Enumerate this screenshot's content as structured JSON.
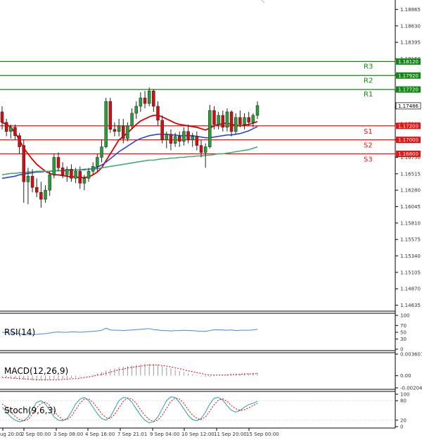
{
  "chart_data": {
    "type": "candlestick",
    "symbol_note": "",
    "price_axis": {
      "ylim": [
        1.1455,
        1.19
      ],
      "ticks": [
        "1.18865",
        "1.18630",
        "1.18395",
        "1.18160",
        "1.17930",
        "1.17700",
        "1.17465",
        "1.17230",
        "1.17000",
        "1.16750",
        "1.16515",
        "1.16280",
        "1.16045",
        "1.15810",
        "1.15575",
        "1.15340",
        "1.15105",
        "1.14870",
        "1.14635"
      ]
    },
    "time_axis": {
      "labels": [
        "ug 20:00",
        "2 Sep 00:00",
        "3 Sep 08:00",
        "4 Sep 16:00",
        "7 Sep 21:01",
        "9 Sep 04:00",
        "10 Sep 12:00",
        "11 Sep 20:00",
        "15 Sep 00:00"
      ]
    },
    "candles": [
      {
        "o": 1.174,
        "h": 1.1748,
        "l": 1.1715,
        "c": 1.1725
      },
      {
        "o": 1.1725,
        "h": 1.173,
        "l": 1.1705,
        "c": 1.1712
      },
      {
        "o": 1.1712,
        "h": 1.1722,
        "l": 1.1702,
        "c": 1.1718
      },
      {
        "o": 1.1718,
        "h": 1.1722,
        "l": 1.17,
        "c": 1.1706
      },
      {
        "o": 1.1706,
        "h": 1.171,
        "l": 1.168,
        "c": 1.169
      },
      {
        "o": 1.1692,
        "h": 1.17,
        "l": 1.161,
        "c": 1.164
      },
      {
        "o": 1.164,
        "h": 1.166,
        "l": 1.1608,
        "c": 1.1648
      },
      {
        "o": 1.1648,
        "h": 1.1658,
        "l": 1.1625,
        "c": 1.1632
      },
      {
        "o": 1.1632,
        "h": 1.1645,
        "l": 1.1618,
        "c": 1.1625
      },
      {
        "o": 1.1625,
        "h": 1.164,
        "l": 1.1603,
        "c": 1.1615
      },
      {
        "o": 1.1615,
        "h": 1.1635,
        "l": 1.161,
        "c": 1.1628
      },
      {
        "o": 1.1628,
        "h": 1.1655,
        "l": 1.162,
        "c": 1.165
      },
      {
        "o": 1.165,
        "h": 1.168,
        "l": 1.1645,
        "c": 1.1675
      },
      {
        "o": 1.1675,
        "h": 1.1682,
        "l": 1.1655,
        "c": 1.166
      },
      {
        "o": 1.166,
        "h": 1.1668,
        "l": 1.1645,
        "c": 1.165
      },
      {
        "o": 1.165,
        "h": 1.1662,
        "l": 1.164,
        "c": 1.1658
      },
      {
        "o": 1.1658,
        "h": 1.1665,
        "l": 1.164,
        "c": 1.1645
      },
      {
        "o": 1.1645,
        "h": 1.166,
        "l": 1.1638,
        "c": 1.1655
      },
      {
        "o": 1.1655,
        "h": 1.1662,
        "l": 1.163,
        "c": 1.1638
      },
      {
        "o": 1.1638,
        "h": 1.165,
        "l": 1.1628,
        "c": 1.1645
      },
      {
        "o": 1.1645,
        "h": 1.166,
        "l": 1.164,
        "c": 1.1655
      },
      {
        "o": 1.1655,
        "h": 1.1668,
        "l": 1.165,
        "c": 1.1662
      },
      {
        "o": 1.1662,
        "h": 1.168,
        "l": 1.1655,
        "c": 1.1675
      },
      {
        "o": 1.1675,
        "h": 1.17,
        "l": 1.1668,
        "c": 1.169
      },
      {
        "o": 1.169,
        "h": 1.176,
        "l": 1.1688,
        "c": 1.1755
      },
      {
        "o": 1.1755,
        "h": 1.176,
        "l": 1.171,
        "c": 1.1715
      },
      {
        "o": 1.1715,
        "h": 1.1725,
        "l": 1.1705,
        "c": 1.1712
      },
      {
        "o": 1.1712,
        "h": 1.173,
        "l": 1.1705,
        "c": 1.172
      },
      {
        "o": 1.172,
        "h": 1.173,
        "l": 1.1695,
        "c": 1.1702
      },
      {
        "o": 1.1702,
        "h": 1.1725,
        "l": 1.1698,
        "c": 1.172
      },
      {
        "o": 1.172,
        "h": 1.1745,
        "l": 1.1715,
        "c": 1.1738
      },
      {
        "o": 1.1738,
        "h": 1.1755,
        "l": 1.173,
        "c": 1.1748
      },
      {
        "o": 1.1748,
        "h": 1.1768,
        "l": 1.174,
        "c": 1.176
      },
      {
        "o": 1.176,
        "h": 1.177,
        "l": 1.1745,
        "c": 1.1752
      },
      {
        "o": 1.1752,
        "h": 1.1775,
        "l": 1.1748,
        "c": 1.177
      },
      {
        "o": 1.177,
        "h": 1.1772,
        "l": 1.174,
        "c": 1.1748
      },
      {
        "o": 1.1748,
        "h": 1.1755,
        "l": 1.172,
        "c": 1.1728
      },
      {
        "o": 1.1728,
        "h": 1.1735,
        "l": 1.1695,
        "c": 1.17
      },
      {
        "o": 1.17,
        "h": 1.1712,
        "l": 1.1688,
        "c": 1.1708
      },
      {
        "o": 1.1708,
        "h": 1.1715,
        "l": 1.1685,
        "c": 1.1695
      },
      {
        "o": 1.1695,
        "h": 1.171,
        "l": 1.169,
        "c": 1.1705
      },
      {
        "o": 1.1705,
        "h": 1.1712,
        "l": 1.169,
        "c": 1.1698
      },
      {
        "o": 1.1698,
        "h": 1.1718,
        "l": 1.1692,
        "c": 1.1712
      },
      {
        "o": 1.1712,
        "h": 1.1722,
        "l": 1.1695,
        "c": 1.17
      },
      {
        "o": 1.17,
        "h": 1.171,
        "l": 1.169,
        "c": 1.1705
      },
      {
        "o": 1.1705,
        "h": 1.1712,
        "l": 1.1685,
        "c": 1.1692
      },
      {
        "o": 1.1692,
        "h": 1.17,
        "l": 1.1675,
        "c": 1.1682
      },
      {
        "o": 1.1682,
        "h": 1.1695,
        "l": 1.166,
        "c": 1.169
      },
      {
        "o": 1.169,
        "h": 1.175,
        "l": 1.1688,
        "c": 1.1742
      },
      {
        "o": 1.1742,
        "h": 1.1748,
        "l": 1.1715,
        "c": 1.1722
      },
      {
        "o": 1.1722,
        "h": 1.174,
        "l": 1.1715,
        "c": 1.1735
      },
      {
        "o": 1.1735,
        "h": 1.1742,
        "l": 1.1712,
        "c": 1.1718
      },
      {
        "o": 1.1718,
        "h": 1.1745,
        "l": 1.1712,
        "c": 1.174
      },
      {
        "o": 1.174,
        "h": 1.1742,
        "l": 1.1705,
        "c": 1.1712
      },
      {
        "o": 1.1712,
        "h": 1.1738,
        "l": 1.1708,
        "c": 1.1732
      },
      {
        "o": 1.1732,
        "h": 1.1742,
        "l": 1.1718,
        "c": 1.1722
      },
      {
        "o": 1.1722,
        "h": 1.1738,
        "l": 1.1715,
        "c": 1.1732
      },
      {
        "o": 1.1732,
        "h": 1.174,
        "l": 1.172,
        "c": 1.1725
      },
      {
        "o": 1.1725,
        "h": 1.1738,
        "l": 1.1718,
        "c": 1.1735
      },
      {
        "o": 1.1735,
        "h": 1.1755,
        "l": 1.173,
        "c": 1.1749
      }
    ],
    "moving_averages": [
      {
        "name": "",
        "color": "#e00000",
        "values": [
          1.1725,
          1.1722,
          1.1718,
          1.171,
          1.17,
          1.1688,
          1.168,
          1.1672,
          1.1665,
          1.166,
          1.1655,
          1.1652,
          1.165,
          1.165,
          1.1649,
          1.1648,
          1.1647,
          1.1647,
          1.1646,
          1.1646,
          1.1647,
          1.165,
          1.1654,
          1.166,
          1.167,
          1.168,
          1.169,
          1.17,
          1.1705,
          1.171,
          1.1716,
          1.1722,
          1.1727,
          1.173,
          1.1733,
          1.1735,
          1.1735,
          1.1733,
          1.173,
          1.1727,
          1.1724,
          1.1722,
          1.1721,
          1.172,
          1.1719,
          1.1718,
          1.1716,
          1.1714,
          1.1717,
          1.172,
          1.1722,
          1.1723,
          1.1724,
          1.1722,
          1.1721,
          1.172,
          1.1721,
          1.1722,
          1.1724,
          1.1726
        ]
      },
      {
        "name": "",
        "color": "#3344cc",
        "values": [
          1.1645,
          1.1646,
          1.1647,
          1.1648,
          1.165,
          1.1651,
          1.1652,
          1.1653,
          1.1654,
          1.1654,
          1.1655,
          1.1655,
          1.1656,
          1.1656,
          1.1656,
          1.1657,
          1.1657,
          1.1657,
          1.1657,
          1.1658,
          1.1658,
          1.1659,
          1.1661,
          1.1664,
          1.1668,
          1.1673,
          1.1678,
          1.1683,
          1.1687,
          1.1691,
          1.1695,
          1.1699,
          1.1702,
          1.1704,
          1.1706,
          1.1707,
          1.1708,
          1.1708,
          1.1708,
          1.1707,
          1.1707,
          1.1706,
          1.1706,
          1.1706,
          1.1706,
          1.1705,
          1.1704,
          1.1703,
          1.1703,
          1.1704,
          1.1705,
          1.1706,
          1.1707,
          1.1707,
          1.1708,
          1.1709,
          1.1711,
          1.1713,
          1.1716,
          1.1719
        ]
      },
      {
        "name": "",
        "color": "#44aa77",
        "values": [
          1.165,
          1.1651,
          1.1652,
          1.1652,
          1.1653,
          1.1653,
          1.1654,
          1.1654,
          1.1655,
          1.1655,
          1.1655,
          1.1655,
          1.1656,
          1.1656,
          1.1656,
          1.1656,
          1.1657,
          1.1657,
          1.1657,
          1.1657,
          1.1658,
          1.1658,
          1.1659,
          1.166,
          1.1661,
          1.1662,
          1.1663,
          1.1664,
          1.1665,
          1.1666,
          1.1667,
          1.1668,
          1.1669,
          1.167,
          1.1671,
          1.1671,
          1.1672,
          1.1673,
          1.1673,
          1.1674,
          1.1674,
          1.1675,
          1.1675,
          1.1676,
          1.1676,
          1.1677,
          1.1677,
          1.1678,
          1.1678,
          1.1679,
          1.168,
          1.168,
          1.1681,
          1.1682,
          1.1683,
          1.1684,
          1.1685,
          1.1686,
          1.1688,
          1.169
        ]
      }
    ],
    "levels": [
      {
        "label": "R3",
        "value": 1.1812,
        "tag": "1.18120",
        "color": "#118811"
      },
      {
        "label": "R2",
        "value": 1.1792,
        "tag": "1.17920",
        "color": "#118811"
      },
      {
        "label": "R1",
        "value": 1.1772,
        "tag": "1.17720",
        "color": "#118811"
      },
      {
        "label": "S1",
        "value": 1.172,
        "tag": "1.17200",
        "color": "#ee1111"
      },
      {
        "label": "S2",
        "value": 1.17,
        "tag": "1.17000",
        "color": "#ee1111"
      },
      {
        "label": "S3",
        "value": 1.168,
        "tag": "1.16800",
        "color": "#ee1111"
      }
    ],
    "current_price": {
      "value": 1.17486,
      "tag": "1.17486"
    },
    "rsi": {
      "label": "RSI(14)",
      "ticks": [
        "100",
        "70",
        "50",
        "30",
        "0"
      ],
      "ylim": [
        0,
        100
      ],
      "values": [
        50,
        49,
        48,
        47,
        46,
        44,
        43,
        43,
        44,
        45,
        46,
        48,
        50,
        51,
        50,
        50,
        51,
        51,
        50,
        51,
        52,
        53,
        54,
        56,
        62,
        57,
        56,
        56,
        55,
        56,
        57,
        58,
        59,
        60,
        61,
        58,
        57,
        55,
        55,
        54,
        55,
        55,
        56,
        55,
        55,
        54,
        53,
        53,
        55,
        58,
        57,
        57,
        56,
        57,
        55,
        56,
        56,
        56,
        57,
        59
      ],
      "color": "#4488dd"
    },
    "macd": {
      "label": "MACD(12,26,9)",
      "ticks": [
        "0.003607",
        "0.00",
        "-0.00204"
      ],
      "ylim": [
        -0.00204,
        0.003607
      ],
      "histogram": [
        -0.0002,
        -0.0003,
        -0.0004,
        -0.0005,
        -0.0006,
        -0.0007,
        -0.0007,
        -0.0008,
        -0.0008,
        -0.0008,
        -0.0008,
        -0.0007,
        -0.0006,
        -0.0006,
        -0.0005,
        -0.0005,
        -0.0004,
        -0.0003,
        -0.0002,
        -0.0001,
        0.0,
        0.0002,
        0.0004,
        0.0006,
        0.0009,
        0.0011,
        0.0012,
        0.0014,
        0.0015,
        0.0016,
        0.0017,
        0.0018,
        0.0019,
        0.002,
        0.002,
        0.0019,
        0.0018,
        0.0016,
        0.0014,
        0.0012,
        0.001,
        0.0008,
        0.0006,
        0.0004,
        0.0002,
        0.0001,
        -0.0001,
        -0.0002,
        -0.0002,
        -0.0001,
        0.0,
        0.0001,
        0.0002,
        0.0002,
        0.0003,
        0.0003,
        0.0004,
        0.0004,
        0.0005,
        0.0005
      ],
      "signal": [
        -0.0003,
        -0.0003,
        -0.0004,
        -0.0004,
        -0.0005,
        -0.0005,
        -0.0006,
        -0.0006,
        -0.0007,
        -0.0007,
        -0.0007,
        -0.0007,
        -0.0007,
        -0.0007,
        -0.0006,
        -0.0006,
        -0.0005,
        -0.0005,
        -0.0004,
        -0.0003,
        -0.0002,
        -0.0001,
        0.0001,
        0.0002,
        0.0004,
        0.0006,
        0.0008,
        0.001,
        0.0011,
        0.0013,
        0.0014,
        0.0015,
        0.0016,
        0.0017,
        0.0018,
        0.0018,
        0.0018,
        0.0017,
        0.0016,
        0.0015,
        0.0013,
        0.0012,
        0.001,
        0.0008,
        0.0007,
        0.0005,
        0.0004,
        0.0002,
        0.0001,
        0.0001,
        0.0001,
        0.0001,
        0.0001,
        0.0002,
        0.0002,
        0.0002,
        0.0003,
        0.0003,
        0.0003,
        0.0004
      ],
      "color": "#e00000"
    },
    "stoch": {
      "label": "Stoch(9,6,3)",
      "ticks": [
        "100",
        "80",
        "20",
        "0"
      ],
      "ylim": [
        0,
        100
      ],
      "k": [
        60,
        45,
        30,
        20,
        15,
        18,
        30,
        55,
        75,
        80,
        70,
        50,
        30,
        20,
        18,
        25,
        45,
        70,
        85,
        90,
        80,
        60,
        40,
        25,
        20,
        30,
        55,
        80,
        90,
        88,
        75,
        55,
        35,
        20,
        12,
        15,
        30,
        55,
        80,
        92,
        90,
        75,
        55,
        35,
        22,
        18,
        25,
        45,
        70,
        88,
        90,
        82,
        65,
        50,
        45,
        50,
        60,
        68,
        72,
        78
      ],
      "d": [
        70,
        60,
        45,
        32,
        22,
        18,
        22,
        38,
        58,
        72,
        76,
        65,
        48,
        32,
        22,
        22,
        32,
        52,
        72,
        85,
        85,
        75,
        58,
        40,
        28,
        25,
        38,
        58,
        78,
        88,
        85,
        72,
        52,
        35,
        22,
        16,
        20,
        35,
        56,
        78,
        88,
        85,
        72,
        52,
        36,
        25,
        22,
        30,
        48,
        68,
        82,
        86,
        78,
        65,
        55,
        50,
        52,
        58,
        65,
        72
      ]
    }
  }
}
